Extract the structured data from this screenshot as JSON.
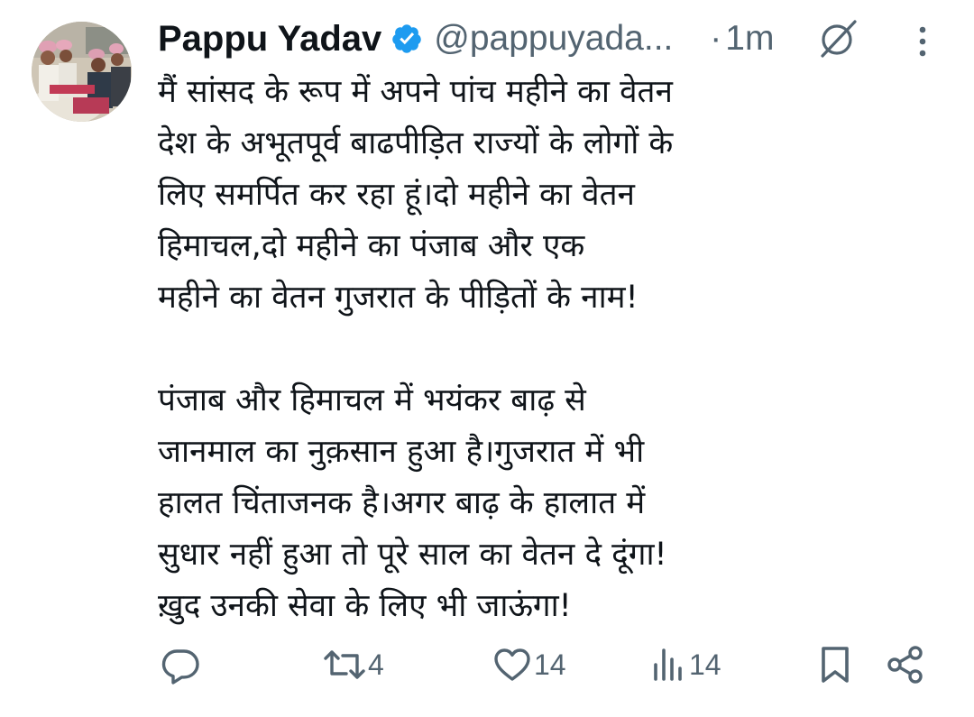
{
  "author": {
    "display_name": "Pappu Yadav",
    "handle": "@pappuyada...",
    "verified": true
  },
  "meta": {
    "separator": "·",
    "time": "1m"
  },
  "tweet": {
    "paragraphs": [
      [
        "मैं सांसद के रूप में अपने पांच महीने का वेतन",
        "देश के अभूतपूर्व बाढपीड़ित राज्यों के लोगों के",
        "लिए समर्पित कर रहा हूं।दो महीने का वेतन",
        "हिमाचल,दो महीने का पंजाब और एक",
        "महीने का वेतन गुजरात के पीड़ितों के नाम!"
      ],
      [
        "पंजाब और हिमाचल में भयंकर बाढ़ से",
        "जानमाल का नुक़सान हुआ है।गुजरात में भी",
        "हालत चिंताजनक है।अगर बाढ़ के हालात में",
        "सुधार नहीं हुआ तो पूरे साल का वेतन दे दूंगा!",
        "ख़ुद उनकी सेवा के लिए भी जाऊंगा!"
      ]
    ]
  },
  "actions": {
    "reply": {
      "icon": "reply-icon",
      "count": ""
    },
    "repost": {
      "icon": "repost-icon",
      "count": "4"
    },
    "like": {
      "icon": "heart-icon",
      "count": "14"
    },
    "views": {
      "icon": "views-icon",
      "count": "14"
    },
    "bookmark": {
      "icon": "bookmark-icon"
    },
    "share": {
      "icon": "share-icon"
    }
  },
  "colors": {
    "text": "#0f1419",
    "secondary": "#536471",
    "verified": "#1d9bf0"
  }
}
